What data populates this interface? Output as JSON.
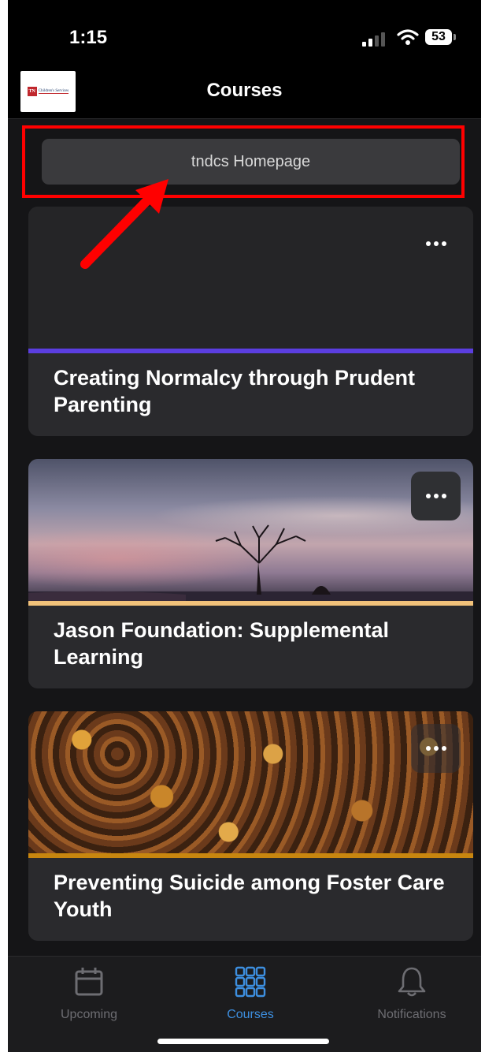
{
  "status_bar": {
    "time": "1:15",
    "battery": "53"
  },
  "header": {
    "title": "Courses",
    "logo_text": "Children's Services",
    "logo_mark": "TN"
  },
  "homepage_button": {
    "label": "tndcs Homepage"
  },
  "courses": [
    {
      "title": "Creating Normalcy through Prudent Parenting",
      "accent_color": "#5b3ee0"
    },
    {
      "title": "Jason Foundation: Supplemental Learning",
      "accent_color": "#f2c27a"
    },
    {
      "title": "Preventing Suicide among Foster Care Youth",
      "accent_color": "#c8860f"
    }
  ],
  "tabs": [
    {
      "label": "Upcoming",
      "icon": "calendar-icon",
      "active": false
    },
    {
      "label": "Courses",
      "icon": "grid-icon",
      "active": true
    },
    {
      "label": "Notifications",
      "icon": "bell-icon",
      "active": false
    }
  ],
  "colors": {
    "highlight": "#ff0000",
    "active_tab": "#3d8fe0"
  }
}
